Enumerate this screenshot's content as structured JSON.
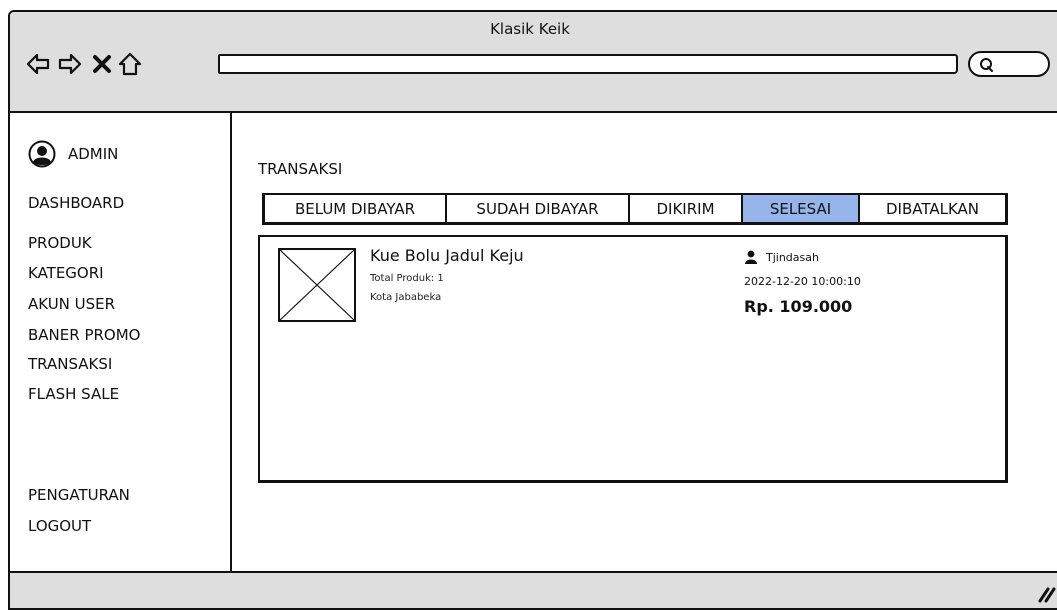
{
  "window": {
    "title": "Klasik Keik"
  },
  "browser": {
    "address_value": "",
    "icons": [
      "back-arrow-icon",
      "forward-arrow-icon",
      "close-x-icon",
      "home-icon",
      "search-icon"
    ]
  },
  "sidebar": {
    "user_label": "ADMIN",
    "items": [
      {
        "label": "DASHBOARD"
      },
      {
        "label": "PRODUK"
      },
      {
        "label": "KATEGORI"
      },
      {
        "label": "AKUN USER"
      },
      {
        "label": "BANER PROMO"
      },
      {
        "label": "TRANSAKSI"
      },
      {
        "label": "FLASH SALE"
      }
    ],
    "bottom_items": [
      {
        "label": "PENGATURAN"
      },
      {
        "label": "LOGOUT"
      }
    ]
  },
  "main": {
    "title": "TRANSAKSI",
    "tabs": [
      {
        "label": "BELUM DIBAYAR",
        "active": false
      },
      {
        "label": "SUDAH DIBAYAR",
        "active": false
      },
      {
        "label": "DIKIRIM",
        "active": false
      },
      {
        "label": "SELESAI",
        "active": true
      },
      {
        "label": "DIBATALKAN",
        "active": false
      }
    ],
    "transaction": {
      "product_name": "Kue Bolu Jadul Keju",
      "total_produk": "Total Produk: 1",
      "city": "Kota Jababeka",
      "customer": "Tjindasah",
      "datetime": "2022-12-20  10:00:10",
      "price": "Rp. 109.000"
    }
  },
  "colors": {
    "active_tab": "#94b4ea",
    "chrome": "#dedede",
    "outline": "#111111"
  }
}
